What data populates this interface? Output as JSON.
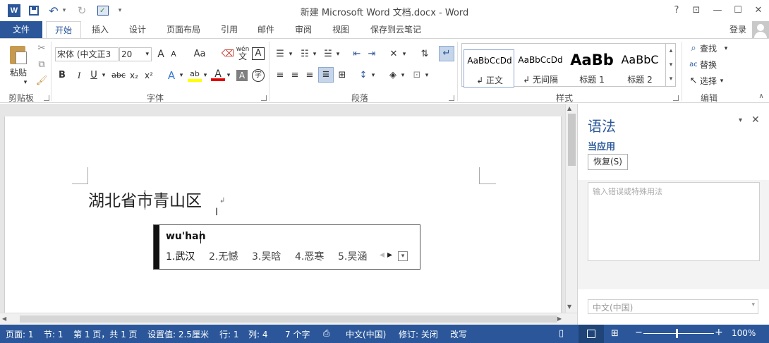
{
  "window": {
    "title": "新建 Microsoft Word 文档.docx - Word",
    "help": "?",
    "controls": {
      "restore_ribbon": "⊡",
      "minimize": "—",
      "maximize": "☐",
      "close": "✕"
    }
  },
  "qat": {
    "word_logo": "W",
    "save": "💾",
    "undo": "↶",
    "redo": "↻",
    "more": "▾"
  },
  "tabs": {
    "file": "文件",
    "home": "开始",
    "insert": "插入",
    "design": "设计",
    "layout": "页面布局",
    "references": "引用",
    "mailings": "邮件",
    "review": "审阅",
    "view": "视图",
    "cloud": "保存到云笔记"
  },
  "account": {
    "login": "登录"
  },
  "clipboard": {
    "paste": "粘贴",
    "group": "剪贴板"
  },
  "font": {
    "name": "宋体 (中文正3",
    "size": "20",
    "grow": "A",
    "shrink": "A",
    "case": "Aa",
    "bold": "B",
    "italic": "I",
    "underline": "U",
    "strike": "abc",
    "sub": "x₂",
    "sup": "x²",
    "text_effect": "A",
    "highlight": "ab",
    "font_color": "A",
    "shade": "A",
    "enclose": "字",
    "phonetic": "wén",
    "border": "A",
    "group": "字体"
  },
  "paragraph": {
    "group": "段落"
  },
  "styles": {
    "items": [
      {
        "sample": "AaBbCcDd",
        "name": "↲ 正文"
      },
      {
        "sample": "AaBbCcDd",
        "name": "↲ 无间隔"
      },
      {
        "sample": "AaBb",
        "name": "标题 1"
      },
      {
        "sample": "AaBbC",
        "name": "标题 2"
      }
    ],
    "group": "样式"
  },
  "editing": {
    "find": "查找",
    "replace": "替换",
    "select": "选择",
    "group": "编辑"
  },
  "document": {
    "text": "湖北省市青山区",
    "para_mark": "↲"
  },
  "ime": {
    "input": "wu'han",
    "candidates": [
      "1.武汉",
      "2.无憾",
      "3.吴晗",
      "4.恶寒",
      "5.吴涵"
    ],
    "prev": "◂",
    "next": "▸",
    "expand": "▾"
  },
  "pane": {
    "title": "语法",
    "subtitle": "当应用",
    "restore_button": "恢复(S)",
    "input_placeholder": "输入错误或特殊用法",
    "language": "中文(中国)",
    "dropdown": "▾",
    "close": "✕"
  },
  "status": {
    "page": "页面: 1",
    "section": "节: 1",
    "pages": "第 1 页，共 1 页",
    "position": "设置值: 2.5厘米",
    "line": "行: 1",
    "column": "列: 4",
    "words": "7 个字",
    "language": "中文(中国)",
    "track": "修订: 关闭",
    "mode": "改写",
    "zoom_minus": "−",
    "zoom_plus": "+",
    "zoom": "100%"
  },
  "colors": {
    "accent": "#2b579a",
    "highlight": "#ffff00",
    "font_red": "#e00000"
  }
}
